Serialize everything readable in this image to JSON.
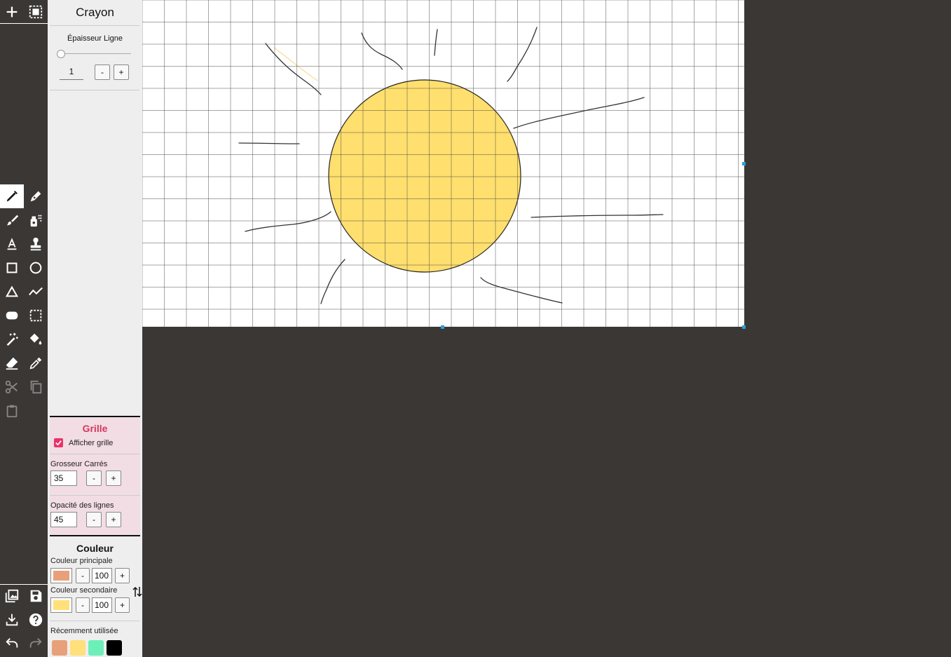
{
  "tool_panel": {
    "title": "Crayon",
    "thickness_label": "Épaisseur Ligne",
    "thickness_value": "1",
    "minus": "-",
    "plus": "+"
  },
  "grid_panel": {
    "title": "Grille",
    "show_grid_label": "Afficher grille",
    "show_grid_checked": true,
    "square_size_label": "Grosseur Carrés",
    "square_size_value": "35",
    "line_opacity_label": "Opacité des lignes",
    "line_opacity_value": "45",
    "minus": "-",
    "plus": "+"
  },
  "color_panel": {
    "title": "Couleur",
    "primary_label": "Couleur principale",
    "primary_color": "#e8a07a",
    "primary_opacity": "100",
    "secondary_label": "Couleur secondaire",
    "secondary_color": "#ffe07a",
    "secondary_opacity": "100",
    "recent_label": "Récemment utilisée",
    "recent_colors": [
      "#e8a07a",
      "#ffe07a",
      "#6df0b8",
      "#000000"
    ],
    "minus": "-",
    "plus": "+"
  },
  "toolbar": {
    "top": [
      "add-icon",
      "select-all-icon"
    ],
    "tools": [
      "pencil-icon",
      "pen-icon",
      "brush-icon",
      "spray-icon",
      "text-icon",
      "stamp-icon",
      "rectangle-icon",
      "circle-icon",
      "triangle-icon",
      "polyline-icon",
      "rounded-rectangle-icon",
      "selection-icon",
      "magic-wand-icon",
      "fill-bucket-icon",
      "eraser-icon",
      "eyedropper-icon",
      "cut-icon",
      "copy-icon",
      "paste-icon"
    ],
    "bottom": [
      "image-icon",
      "save-icon",
      "download-icon",
      "help-icon",
      "undo-icon",
      "redo-icon"
    ]
  },
  "canvas": {
    "grid_square_size": 35,
    "grid_opacity": 45,
    "sun_fill": "#ffdf6e"
  }
}
